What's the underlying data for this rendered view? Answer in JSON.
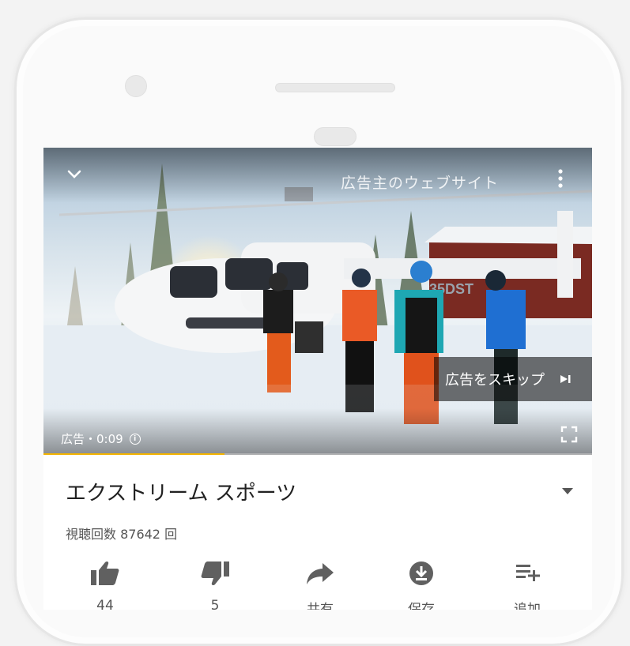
{
  "video": {
    "advertiser_link": "広告主のウェブサイト",
    "skip_label": "広告をスキップ",
    "ad_label": "広告・0:09",
    "progress": 0.33
  },
  "info": {
    "title": "エクストリーム スポーツ",
    "views": "視聴回数 87642 回"
  },
  "actions": [
    {
      "icon": "thumbs-up-icon",
      "label": "44"
    },
    {
      "icon": "thumbs-down-icon",
      "label": "5"
    },
    {
      "icon": "share-icon",
      "label": "共有"
    },
    {
      "icon": "download-icon",
      "label": "保存"
    },
    {
      "icon": "add-to-playlist-icon",
      "label": "追加"
    }
  ],
  "colors": {
    "progress": "#f4b400",
    "icon": "#606060"
  }
}
